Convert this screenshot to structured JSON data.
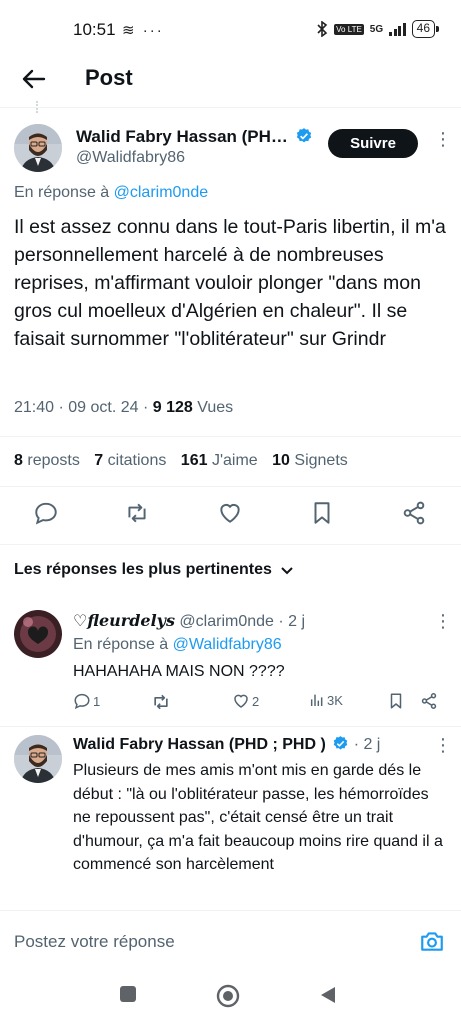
{
  "status_bar": {
    "time": "10:51",
    "left_icons": "≋ ···",
    "network": "5G",
    "volte": "Vo LTE",
    "battery": "46"
  },
  "header": {
    "title": "Post",
    "back_icon": "arrow-left-icon"
  },
  "tweet": {
    "author_name": "Walid Fabry Hassan (PH…",
    "author_handle": "@Walidfabry86",
    "follow_label": "Suivre",
    "reply_to_prefix": "En réponse à ",
    "reply_to_handle": "@clarim0nde",
    "text": "Il est assez connu dans le tout-Paris libertin, il m'a personnellement harcelé à de nombreuses reprises, m'affirmant vouloir plonger \"dans mon gros cul moelleux d'Algérien en chaleur\". Il se faisait surnommer \"l'oblitérateur\" sur Grindr",
    "time": "21:40 · 09 oct. 24 · ",
    "views_count": "9 128",
    "views_label": " Vues",
    "stats": {
      "reposts_count": "8",
      "reposts_label": "reposts",
      "quotes_count": "7",
      "quotes_label": "citations",
      "likes_count": "161",
      "likes_label": "J'aime",
      "bookmarks_count": "10",
      "bookmarks_label": "Signets"
    },
    "verified_color": "#1d9bf0"
  },
  "sort": {
    "label": "Les réponses les plus pertinentes"
  },
  "replies": [
    {
      "author_name": "♡fleurdelys",
      "author_handle": "@clarim0nde · 2 j",
      "reply_to_prefix": "En réponse à ",
      "reply_to_handle": "@Walidfabry86",
      "text": "HAHAHAHA MAIS NON ????",
      "replies_count": "1",
      "reposts_count": "",
      "likes_count": "2",
      "views_count": "3K"
    },
    {
      "author_name": "Walid Fabry Hassan (PHD ; PHD )",
      "author_handle": " · 2 j",
      "text": "Plusieurs de mes amis m'ont mis en garde dés le début : \"là ou l'oblitérateur passe, les hémorroïdes ne repoussent pas\", c'était censé être un trait d'humour, ça m'a fait beaucoup moins rire quand il a commencé son harcèlement"
    }
  ],
  "compose": {
    "placeholder": "Postez votre réponse"
  },
  "colors": {
    "accent": "#1d9bf0",
    "text": "#0f1419",
    "secondary": "#536471"
  }
}
